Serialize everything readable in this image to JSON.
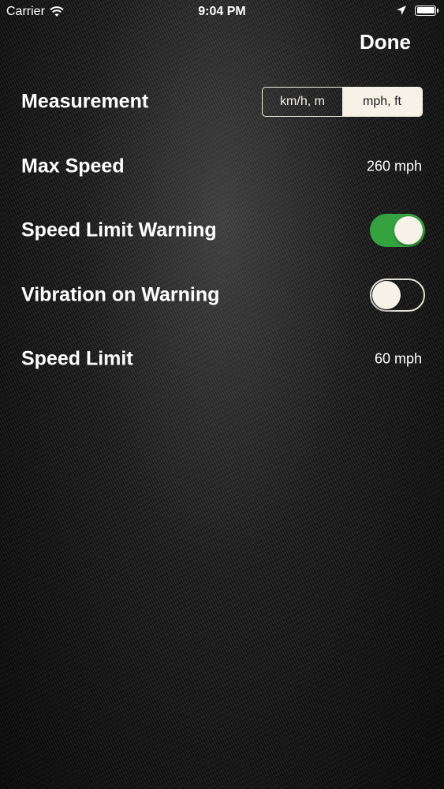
{
  "status_bar": {
    "carrier": "Carrier",
    "time": "9:04 PM"
  },
  "nav": {
    "done_label": "Done"
  },
  "settings": {
    "measurement": {
      "label": "Measurement",
      "options": [
        "km/h, m",
        "mph, ft"
      ],
      "selected": "mph, ft"
    },
    "max_speed": {
      "label": "Max Speed",
      "value": "260 mph"
    },
    "speed_limit_warning": {
      "label": "Speed Limit Warning",
      "enabled": true
    },
    "vibration_on_warning": {
      "label": "Vibration on Warning",
      "enabled": false
    },
    "speed_limit": {
      "label": "Speed Limit",
      "value": "60 mph"
    }
  },
  "colors": {
    "toggle_on": "#34a33f",
    "segment_selected_bg": "#f6f2e8",
    "text": "#ffffff"
  }
}
